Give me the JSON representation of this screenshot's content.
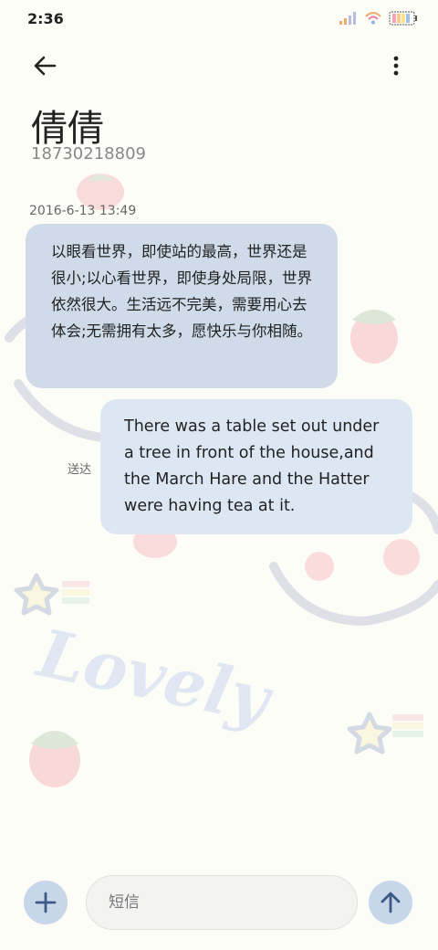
{
  "status": {
    "time": "2:36"
  },
  "contact": {
    "name": "倩倩",
    "phone": "18730218809"
  },
  "thread": {
    "timestamp": "2016-6-13 13:49",
    "incoming_text": "以眼看世界，即使站的最高，世界还是很小;以心看世界，即使身处局限，世界依然很大。生活远不完美，需要用心去体会;无需拥有太多，愿快乐与你相随。",
    "outgoing_text": "There was a table set out under a tree in front of the house,and the March Hare and the Hatter were having tea at it.",
    "sent_status": "送达"
  },
  "wallpaper": {
    "word": "Lovely"
  },
  "composer": {
    "placeholder": "短信"
  },
  "icons": [
    "back-arrow-icon",
    "more-icon",
    "signal-icon",
    "wifi-icon",
    "battery-icon",
    "add-icon",
    "send-arrow-icon"
  ],
  "colors": {
    "bubble_incoming": "#cfdbe9",
    "bubble_outgoing": "#dde7f4",
    "button": "#c8d6ea",
    "icon_accent": "#3d5a86"
  }
}
